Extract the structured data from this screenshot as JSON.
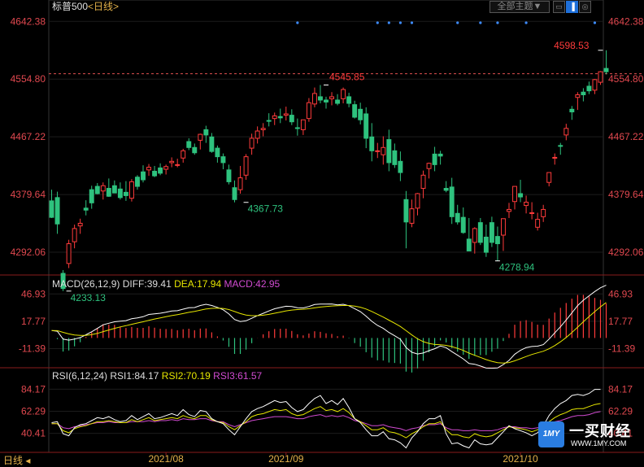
{
  "header": {
    "title": "标普500",
    "period": "<日线>",
    "theme_button": "全部主题▼"
  },
  "footer": {
    "period_tab": "日线"
  },
  "brand": {
    "name": "一买财经",
    "url": "WWW.1MY.COM",
    "logo_text": "1MY"
  },
  "colors": {
    "up": "#ff3b3b",
    "down": "#2ec27e",
    "axis_text": "#e0484f",
    "white_line": "#ffffff",
    "yellow_line": "#e6e600",
    "magenta_line": "#d14bd1",
    "current_line": "#e05050",
    "marker": "#3d8bfd"
  },
  "chart_data": [
    {
      "type": "candlestick",
      "name": "price",
      "ylim": [
        4260,
        4660
      ],
      "yticks": [
        4642.38,
        4554.8,
        4467.22,
        4379.64,
        4292.06
      ],
      "current_price_line": 4563,
      "annotations": [
        {
          "label": "4233.13",
          "index": 3,
          "value": 4233.13,
          "color": "down"
        },
        {
          "label": "4367.73",
          "index": 34,
          "value": 4367.73,
          "color": "down"
        },
        {
          "label": "4545.85",
          "index": 48,
          "value": 4545.85,
          "color": "up"
        },
        {
          "label": "4278.94",
          "index": 78,
          "value": 4278.94,
          "color": "down"
        },
        {
          "label": "4598.53",
          "index": 96,
          "value": 4598.53,
          "color": "up"
        }
      ],
      "event_markers": [
        43,
        57,
        59,
        61,
        63,
        71,
        75,
        78,
        83,
        95
      ],
      "candles": [
        [
          4370,
          4387,
          4344,
          4345
        ],
        [
          4375,
          4384,
          4320,
          4335
        ],
        [
          4260,
          4265,
          4233.13,
          4237
        ],
        [
          4275,
          4311,
          4268,
          4305
        ],
        [
          4308,
          4334,
          4298,
          4328
        ],
        [
          4332,
          4343,
          4320,
          4336
        ],
        [
          4359,
          4371,
          4348,
          4356
        ],
        [
          4387,
          4393,
          4358,
          4367
        ],
        [
          4392,
          4397,
          4380,
          4381
        ],
        [
          4385,
          4398,
          4372,
          4393
        ],
        [
          4389,
          4404,
          4376,
          4377
        ],
        [
          4393,
          4401,
          4382,
          4382
        ],
        [
          4388,
          4398,
          4372,
          4375
        ],
        [
          4383,
          4400,
          4370,
          4378
        ],
        [
          4374,
          4403,
          4369,
          4399
        ],
        [
          4406,
          4409,
          4387,
          4392
        ],
        [
          4414,
          4424,
          4398,
          4402
        ],
        [
          4417,
          4426,
          4408,
          4421
        ],
        [
          4415,
          4423,
          4406,
          4408
        ],
        [
          4420,
          4427,
          4409,
          4412
        ],
        [
          4418,
          4425,
          4410,
          4422
        ],
        [
          4428,
          4436,
          4421,
          4430
        ],
        [
          4424,
          4434,
          4421,
          4425
        ],
        [
          4435,
          4449,
          4428,
          4446
        ],
        [
          4460,
          4465,
          4447,
          4451
        ],
        [
          4451,
          4457,
          4440,
          4443
        ],
        [
          4462,
          4472,
          4448,
          4471
        ],
        [
          4478,
          4484,
          4458,
          4470
        ],
        [
          4467,
          4473,
          4443,
          4445
        ],
        [
          4450,
          4454,
          4428,
          4437
        ],
        [
          4437,
          4442,
          4418,
          4428
        ],
        [
          4417,
          4425,
          4395,
          4399
        ],
        [
          4390,
          4401,
          4367.73,
          4372
        ],
        [
          4387,
          4423,
          4381,
          4405
        ],
        [
          4409,
          4441,
          4402,
          4437
        ],
        [
          4450,
          4472,
          4440,
          4465
        ],
        [
          4465,
          4483,
          4457,
          4476
        ],
        [
          4478,
          4488,
          4468,
          4480
        ],
        [
          4492,
          4503,
          4483,
          4491
        ],
        [
          4495,
          4504,
          4485,
          4499
        ],
        [
          4498,
          4510,
          4488,
          4496
        ],
        [
          4500,
          4513,
          4492,
          4502
        ],
        [
          4500,
          4509,
          4485,
          4490
        ],
        [
          4481,
          4495,
          4469,
          4480
        ],
        [
          4478,
          4493,
          4470,
          4493
        ],
        [
          4495,
          4526,
          4490,
          4519
        ],
        [
          4517,
          4542,
          4512,
          4533
        ],
        [
          4528,
          4545.85,
          4518,
          4523
        ],
        [
          4523,
          4528,
          4510,
          4520
        ],
        [
          4525,
          4535,
          4515,
          4528
        ],
        [
          4523,
          4532,
          4515,
          4518
        ],
        [
          4525,
          4542,
          4518,
          4539
        ],
        [
          4528,
          4534,
          4512,
          4518
        ],
        [
          4516,
          4522,
          4495,
          4497
        ],
        [
          4509,
          4519,
          4486,
          4493
        ],
        [
          4502,
          4512,
          4450,
          4465
        ],
        [
          4467,
          4488,
          4430,
          4446
        ],
        [
          4446,
          4458,
          4435,
          4446
        ],
        [
          4440,
          4468,
          4425,
          4451
        ],
        [
          4463,
          4478,
          4415,
          4428
        ],
        [
          4446,
          4457,
          4420,
          4425
        ],
        [
          4430,
          4445,
          4400,
          4413
        ],
        [
          4372,
          4385,
          4298,
          4338
        ],
        [
          4336,
          4372,
          4330,
          4358
        ],
        [
          4359,
          4382,
          4348,
          4381
        ],
        [
          4389,
          4416,
          4374,
          4409
        ],
        [
          4419,
          4428,
          4404,
          4427
        ],
        [
          4441,
          4452,
          4415,
          4425
        ],
        [
          4441,
          4446,
          4425,
          4438
        ],
        [
          4389,
          4400,
          4383,
          4386
        ],
        [
          4391,
          4405,
          4335,
          4346
        ],
        [
          4351,
          4364,
          4334,
          4338
        ],
        [
          4345,
          4360,
          4320,
          4322
        ],
        [
          4312,
          4344,
          4295,
          4294
        ],
        [
          4307,
          4330,
          4290,
          4328
        ],
        [
          4337,
          4344,
          4303,
          4307
        ],
        [
          4315,
          4334,
          4285,
          4292
        ],
        [
          4337,
          4346,
          4300,
          4307
        ],
        [
          4316,
          4331,
          4278.94,
          4305
        ],
        [
          4318,
          4339,
          4294,
          4343
        ],
        [
          4354,
          4367,
          4344,
          4357
        ],
        [
          4369,
          4392,
          4357,
          4392
        ],
        [
          4381,
          4402,
          4368,
          4376
        ],
        [
          4363,
          4378,
          4351,
          4368
        ],
        [
          4352,
          4368,
          4342,
          4352
        ],
        [
          4330,
          4352,
          4325,
          4342
        ],
        [
          4346,
          4364,
          4338,
          4357
        ],
        [
          4398,
          4410,
          4392,
          4413
        ],
        [
          4435,
          4442,
          4425,
          4436
        ],
        [
          4454,
          4458,
          4440,
          4453
        ],
        [
          4470,
          4487,
          4462,
          4480
        ],
        [
          4509,
          4514,
          4493,
          4505
        ],
        [
          4527,
          4535,
          4508,
          4531
        ],
        [
          4535,
          4541,
          4521,
          4531
        ],
        [
          4544,
          4551,
          4532,
          4537
        ],
        [
          4538,
          4555,
          4532,
          4554
        ],
        [
          4550,
          4567,
          4546,
          4566
        ],
        [
          4571,
          4598.53,
          4562,
          4566
        ]
      ]
    },
    {
      "type": "macd",
      "name": "MACD",
      "legend": "MACD(26,12,9)",
      "values": {
        "DIFF": "DIFF:39.41",
        "DEA": "DEA:17.94",
        "MACD": "MACD:42.95"
      },
      "ylim": [
        -30,
        55
      ],
      "yticks": [
        46.93,
        17.77,
        -11.39
      ]
    },
    {
      "type": "rsi",
      "name": "RSI",
      "legend": "RSI(6,12,24)",
      "values": {
        "RSI1": "RSI1:84.17",
        "RSI2": "RSI2:70.19",
        "RSI3": "RSI3:61.57"
      },
      "ylim": [
        28,
        95
      ],
      "yticks": [
        84.17,
        62.29,
        40.41
      ],
      "rsi1": [
        51,
        52,
        40,
        38,
        46,
        49,
        50,
        53,
        56,
        55,
        57,
        54,
        52,
        53,
        58,
        54,
        57,
        60,
        55,
        56,
        58,
        60,
        58,
        64,
        59,
        57,
        63,
        62,
        55,
        52,
        50,
        44,
        39,
        47,
        55,
        62,
        65,
        67,
        70,
        73,
        71,
        72,
        66,
        62,
        64,
        70,
        75,
        78,
        70,
        73,
        69,
        75,
        66,
        55,
        51,
        44,
        38,
        38,
        42,
        35,
        34,
        31,
        26,
        36,
        42,
        50,
        55,
        55,
        58,
        40,
        30,
        31,
        28,
        26,
        34,
        30,
        29,
        30,
        36,
        42,
        48,
        45,
        43,
        41,
        38,
        41,
        48,
        58,
        65,
        70,
        73,
        78,
        79,
        78,
        80,
        84,
        84
      ],
      "rsi2": [
        50,
        50,
        43,
        41,
        45,
        47,
        48,
        50,
        52,
        52,
        53,
        52,
        51,
        51,
        54,
        52,
        54,
        56,
        53,
        54,
        55,
        56,
        55,
        58,
        56,
        55,
        58,
        58,
        54,
        52,
        51,
        47,
        44,
        48,
        52,
        57,
        59,
        60,
        62,
        64,
        63,
        64,
        60,
        58,
        59,
        62,
        65,
        67,
        63,
        64,
        62,
        65,
        61,
        55,
        52,
        48,
        44,
        44,
        46,
        42,
        41,
        39,
        36,
        40,
        43,
        47,
        50,
        50,
        52,
        44,
        39,
        39,
        37,
        36,
        40,
        38,
        37,
        38,
        41,
        44,
        47,
        46,
        45,
        44,
        42,
        44,
        47,
        52,
        56,
        59,
        61,
        64,
        65,
        65,
        67,
        69,
        70
      ],
      "rsi3": [
        50,
        50,
        46,
        45,
        47,
        48,
        49,
        50,
        51,
        51,
        52,
        51,
        51,
        51,
        52,
        52,
        52,
        53,
        52,
        53,
        53,
        54,
        53,
        55,
        54,
        54,
        55,
        55,
        53,
        52,
        52,
        49,
        47,
        49,
        51,
        53,
        54,
        55,
        56,
        57,
        57,
        57,
        56,
        55,
        55,
        57,
        58,
        59,
        57,
        58,
        57,
        58,
        56,
        53,
        52,
        50,
        48,
        48,
        49,
        47,
        46,
        45,
        43,
        45,
        46,
        48,
        49,
        49,
        50,
        46,
        44,
        44,
        43,
        43,
        44,
        43,
        43,
        43,
        44,
        46,
        47,
        47,
        46,
        46,
        45,
        46,
        47,
        50,
        52,
        53,
        55,
        57,
        58,
        58,
        59,
        61,
        62
      ]
    }
  ],
  "x_axis": {
    "labels": [
      "2021/08",
      "2021/09",
      "2021/10"
    ],
    "label_index": [
      20,
      41,
      82
    ]
  }
}
